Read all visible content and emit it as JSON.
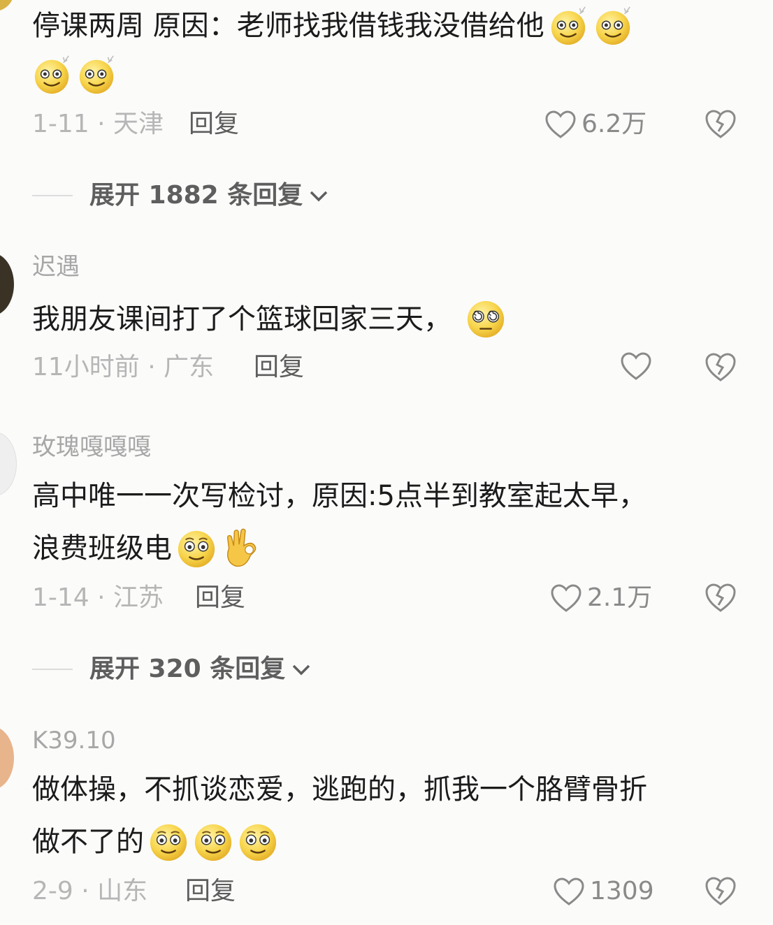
{
  "comments": [
    {
      "username": "",
      "lines": [
        "停课两周  原因：老师找我借钱我没借给他",
        ""
      ],
      "emojis_line1": [
        "dizzy-smile-emoji",
        "dizzy-smile-emoji"
      ],
      "emojis_line2": [
        "dizzy-smile-emoji",
        "dizzy-smile-emoji"
      ],
      "meta": "1-11 · 天津",
      "reply_label": "回复",
      "likes": "6.2万",
      "expand_label": "展开 1882 条回复"
    },
    {
      "username": "迟遇",
      "lines": [
        "我朋友课间打了个篮球回家三天，"
      ],
      "emojis_line1": [
        "swirl-eyes-emoji"
      ],
      "meta": "11小时前 · 广东",
      "reply_label": "回复",
      "likes": ""
    },
    {
      "username": "玫瑰嘎嘎嘎",
      "lines": [
        "高中唯一一次写检讨，原因:5点半到教室起太早，",
        "浪费班级电"
      ],
      "emojis_line2": [
        "blank-stare-emoji",
        "ok-hand-emoji"
      ],
      "meta": "1-14 · 江苏",
      "reply_label": "回复",
      "likes": "2.1万",
      "expand_label": "展开 320 条回复"
    },
    {
      "username": "K39.10",
      "lines": [
        "做体操，不抓谈恋爱，逃跑的，抓我一个胳臂骨折",
        "做不了的"
      ],
      "emojis_line2": [
        "blank-stare-emoji",
        "blank-stare-emoji",
        "blank-stare-emoji"
      ],
      "meta": "2-9 · 山东",
      "reply_label": "回复",
      "likes": "1309"
    }
  ],
  "icons": {
    "like": "heart-outline-icon",
    "dislike": "broken-heart-icon",
    "expand": "chevron-down-icon"
  },
  "colors": {
    "background": "#fbfbfa",
    "text": "#1b1b1b",
    "meta": "#b6b6b6",
    "emoji": "#f7d44a"
  }
}
